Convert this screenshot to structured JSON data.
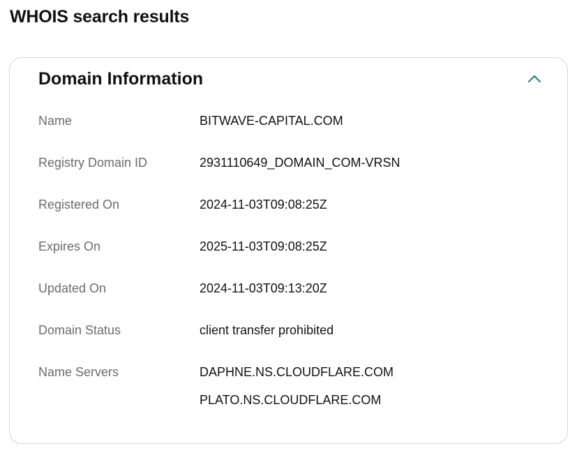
{
  "page": {
    "title": "WHOIS search results"
  },
  "card": {
    "title": "Domain Information",
    "toggle_icon": "chevron-up-icon",
    "accent_color": "#1a7b7b"
  },
  "fields": {
    "name": {
      "label": "Name",
      "value": "BITWAVE-CAPITAL.COM"
    },
    "registry_domain_id": {
      "label": "Registry Domain ID",
      "value": "2931110649_DOMAIN_COM-VRSN"
    },
    "registered_on": {
      "label": "Registered On",
      "value": "2024-11-03T09:08:25Z"
    },
    "expires_on": {
      "label": "Expires On",
      "value": "2025-11-03T09:08:25Z"
    },
    "updated_on": {
      "label": "Updated On",
      "value": "2024-11-03T09:13:20Z"
    },
    "domain_status": {
      "label": "Domain Status",
      "value": "client transfer prohibited"
    },
    "name_servers": {
      "label": "Name Servers",
      "values": [
        "DAPHNE.NS.CLOUDFLARE.COM",
        "PLATO.NS.CLOUDFLARE.COM"
      ]
    }
  }
}
